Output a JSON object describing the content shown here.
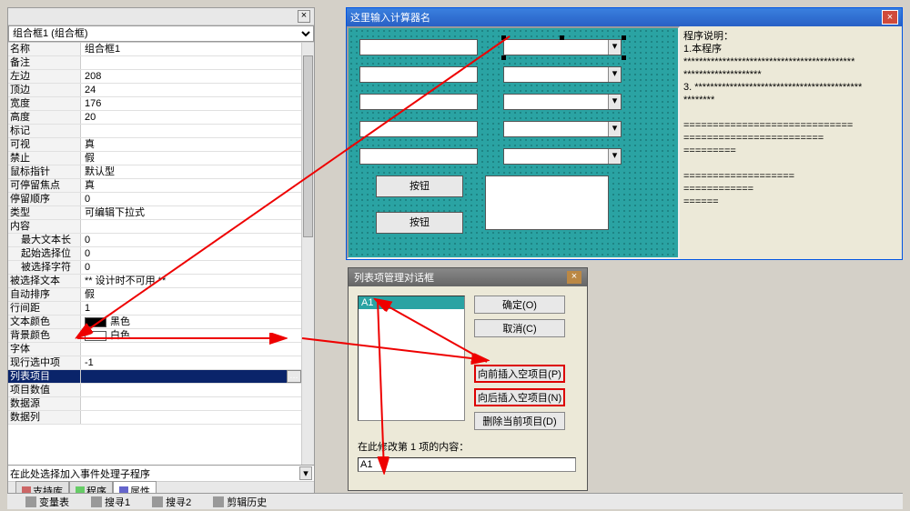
{
  "prop_panel": {
    "object_selector": "组合框1 (组合框)",
    "rows": [
      {
        "k": "名称",
        "v": "组合框1"
      },
      {
        "k": "备注",
        "v": ""
      },
      {
        "k": "左边",
        "v": "208"
      },
      {
        "k": "顶边",
        "v": "24"
      },
      {
        "k": "宽度",
        "v": "176"
      },
      {
        "k": "高度",
        "v": "20"
      },
      {
        "k": "标记",
        "v": ""
      },
      {
        "k": "可视",
        "v": "真"
      },
      {
        "k": "禁止",
        "v": "假"
      },
      {
        "k": "鼠标指针",
        "v": "默认型"
      },
      {
        "k": "可停留焦点",
        "v": "真"
      },
      {
        "k": "停留顺序",
        "v": "0"
      },
      {
        "k": "类型",
        "v": "可编辑下拉式"
      },
      {
        "k": "内容",
        "v": ""
      },
      {
        "k": "最大文本长度",
        "v": "0",
        "indent": true
      },
      {
        "k": "起始选择位置",
        "v": "0",
        "indent": true
      },
      {
        "k": "被选择字符数",
        "v": "0",
        "indent": true
      },
      {
        "k": "被选择文本",
        "v": "** 设计时不可用 **"
      },
      {
        "k": "自动排序",
        "v": "假"
      },
      {
        "k": "行间距",
        "v": "1"
      },
      {
        "k": "文本颜色",
        "v": "黑色",
        "swatch": "#000000"
      },
      {
        "k": "背景颜色",
        "v": "白色",
        "swatch": "#ffffff"
      },
      {
        "k": "字体",
        "v": ""
      },
      {
        "k": "现行选中项",
        "v": "-1"
      },
      {
        "k": "列表项目",
        "v": "",
        "selected": true,
        "btn": true
      },
      {
        "k": "项目数值",
        "v": ""
      },
      {
        "k": "数据源",
        "v": ""
      },
      {
        "k": "数据列",
        "v": ""
      }
    ],
    "event_placeholder": "在此处选择加入事件处理子程序",
    "tabs": [
      "支持库",
      "程序",
      "属性"
    ],
    "active_tab": 2
  },
  "bottom_bar": [
    "变量表",
    "搜寻1",
    "搜寻2",
    "剪辑历史"
  ],
  "main_win": {
    "title": "这里输入计算器名",
    "button_label": "按钮",
    "desc_heading": "程序说明：",
    "desc_lines": [
      "1.本程序",
      "********************************************",
      "********************",
      "3. *******************************************",
      "********",
      "",
      "=============================",
      "========================",
      "=========",
      "",
      "===================",
      "============",
      "======"
    ]
  },
  "dialog": {
    "title": "列表项管理对话框",
    "list_item": "A1",
    "buttons": {
      "ok": "确定(O)",
      "cancel": "取消(C)",
      "ins_before": "向前插入空项目(P)",
      "ins_after": "向后插入空项目(N)",
      "del": "删除当前项目(D)"
    },
    "edit_label": "在此修改第 1 项的内容：",
    "edit_value": "A1"
  },
  "icons": {
    "close": "×",
    "dropdown": "▾",
    "ellipsis": "..."
  }
}
